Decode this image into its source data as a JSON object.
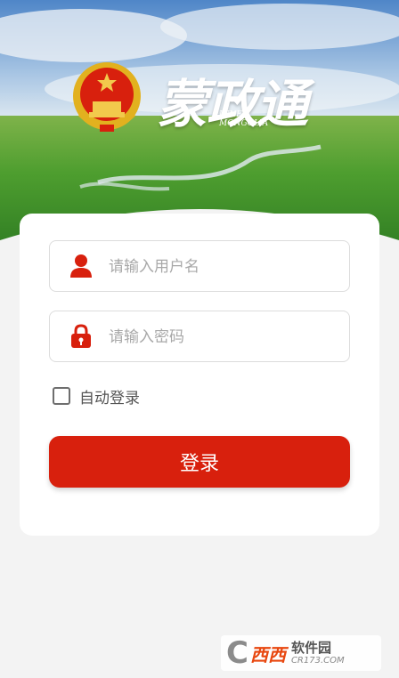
{
  "header": {
    "brand_text": "蒙政通",
    "inner_line1": "INNER",
    "inner_line2": "MONGOLIA"
  },
  "login": {
    "username_placeholder": "请输入用户名",
    "password_placeholder": "请输入密码",
    "remember_label": "自动登录",
    "remember_checked": false,
    "submit_label": "登录"
  },
  "watermark": {
    "brand": "西西",
    "suffix": "软件园",
    "url": "CR173.COM"
  },
  "colors": {
    "accent": "#d8200d",
    "sky": "#6fa2d8",
    "grass": "#3f9a2e"
  },
  "icons": {
    "username": "user-icon",
    "password": "lock-icon",
    "emblem": "national-emblem-icon"
  }
}
